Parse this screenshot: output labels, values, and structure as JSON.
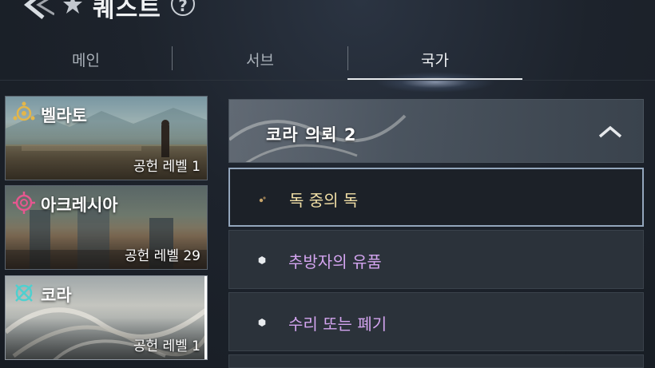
{
  "header": {
    "title": "퀘스트",
    "help_label": "?"
  },
  "tabs": [
    {
      "label": "메인",
      "active": false
    },
    {
      "label": "서브",
      "active": false
    },
    {
      "label": "국가",
      "active": true
    }
  ],
  "nations": [
    {
      "name": "벨라토",
      "level": "공헌 레벨 1",
      "emblem": "bellato-emblem-icon",
      "emblem_color": "#e3b64a",
      "selected": false
    },
    {
      "name": "아크레시아",
      "level": "공헌 레벨 29",
      "emblem": "accretia-emblem-icon",
      "emblem_color": "#e5578f",
      "selected": false
    },
    {
      "name": "코라",
      "level": "공헌 레벨 1",
      "emblem": "cora-emblem-icon",
      "emblem_color": "#4fd0cf",
      "selected": true
    }
  ],
  "quest_group": {
    "title": "코라 의뢰 2",
    "expanded": true
  },
  "quests": [
    {
      "label": "독 중의 독",
      "active": true,
      "color": "#f1dfa6"
    },
    {
      "label": "추방자의 유품",
      "active": false,
      "color": "#d3a4ef"
    },
    {
      "label": "수리 또는 폐기",
      "active": false,
      "color": "#d3a4ef"
    }
  ],
  "colors": {
    "accent_active_border": "#93a6bc",
    "active_quest_text": "#f1dfa6",
    "sub_quest_text": "#d3a4ef"
  }
}
